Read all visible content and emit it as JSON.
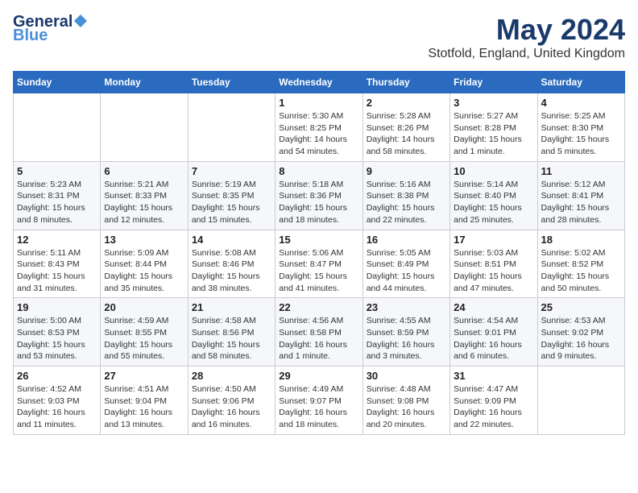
{
  "header": {
    "logo_general": "General",
    "logo_blue": "Blue",
    "title": "May 2024",
    "location": "Stotfold, England, United Kingdom"
  },
  "weekdays": [
    "Sunday",
    "Monday",
    "Tuesday",
    "Wednesday",
    "Thursday",
    "Friday",
    "Saturday"
  ],
  "weeks": [
    [
      {
        "day": "",
        "info": ""
      },
      {
        "day": "",
        "info": ""
      },
      {
        "day": "",
        "info": ""
      },
      {
        "day": "1",
        "info": "Sunrise: 5:30 AM\nSunset: 8:25 PM\nDaylight: 14 hours\nand 54 minutes."
      },
      {
        "day": "2",
        "info": "Sunrise: 5:28 AM\nSunset: 8:26 PM\nDaylight: 14 hours\nand 58 minutes."
      },
      {
        "day": "3",
        "info": "Sunrise: 5:27 AM\nSunset: 8:28 PM\nDaylight: 15 hours\nand 1 minute."
      },
      {
        "day": "4",
        "info": "Sunrise: 5:25 AM\nSunset: 8:30 PM\nDaylight: 15 hours\nand 5 minutes."
      }
    ],
    [
      {
        "day": "5",
        "info": "Sunrise: 5:23 AM\nSunset: 8:31 PM\nDaylight: 15 hours\nand 8 minutes."
      },
      {
        "day": "6",
        "info": "Sunrise: 5:21 AM\nSunset: 8:33 PM\nDaylight: 15 hours\nand 12 minutes."
      },
      {
        "day": "7",
        "info": "Sunrise: 5:19 AM\nSunset: 8:35 PM\nDaylight: 15 hours\nand 15 minutes."
      },
      {
        "day": "8",
        "info": "Sunrise: 5:18 AM\nSunset: 8:36 PM\nDaylight: 15 hours\nand 18 minutes."
      },
      {
        "day": "9",
        "info": "Sunrise: 5:16 AM\nSunset: 8:38 PM\nDaylight: 15 hours\nand 22 minutes."
      },
      {
        "day": "10",
        "info": "Sunrise: 5:14 AM\nSunset: 8:40 PM\nDaylight: 15 hours\nand 25 minutes."
      },
      {
        "day": "11",
        "info": "Sunrise: 5:12 AM\nSunset: 8:41 PM\nDaylight: 15 hours\nand 28 minutes."
      }
    ],
    [
      {
        "day": "12",
        "info": "Sunrise: 5:11 AM\nSunset: 8:43 PM\nDaylight: 15 hours\nand 31 minutes."
      },
      {
        "day": "13",
        "info": "Sunrise: 5:09 AM\nSunset: 8:44 PM\nDaylight: 15 hours\nand 35 minutes."
      },
      {
        "day": "14",
        "info": "Sunrise: 5:08 AM\nSunset: 8:46 PM\nDaylight: 15 hours\nand 38 minutes."
      },
      {
        "day": "15",
        "info": "Sunrise: 5:06 AM\nSunset: 8:47 PM\nDaylight: 15 hours\nand 41 minutes."
      },
      {
        "day": "16",
        "info": "Sunrise: 5:05 AM\nSunset: 8:49 PM\nDaylight: 15 hours\nand 44 minutes."
      },
      {
        "day": "17",
        "info": "Sunrise: 5:03 AM\nSunset: 8:51 PM\nDaylight: 15 hours\nand 47 minutes."
      },
      {
        "day": "18",
        "info": "Sunrise: 5:02 AM\nSunset: 8:52 PM\nDaylight: 15 hours\nand 50 minutes."
      }
    ],
    [
      {
        "day": "19",
        "info": "Sunrise: 5:00 AM\nSunset: 8:53 PM\nDaylight: 15 hours\nand 53 minutes."
      },
      {
        "day": "20",
        "info": "Sunrise: 4:59 AM\nSunset: 8:55 PM\nDaylight: 15 hours\nand 55 minutes."
      },
      {
        "day": "21",
        "info": "Sunrise: 4:58 AM\nSunset: 8:56 PM\nDaylight: 15 hours\nand 58 minutes."
      },
      {
        "day": "22",
        "info": "Sunrise: 4:56 AM\nSunset: 8:58 PM\nDaylight: 16 hours\nand 1 minute."
      },
      {
        "day": "23",
        "info": "Sunrise: 4:55 AM\nSunset: 8:59 PM\nDaylight: 16 hours\nand 3 minutes."
      },
      {
        "day": "24",
        "info": "Sunrise: 4:54 AM\nSunset: 9:01 PM\nDaylight: 16 hours\nand 6 minutes."
      },
      {
        "day": "25",
        "info": "Sunrise: 4:53 AM\nSunset: 9:02 PM\nDaylight: 16 hours\nand 9 minutes."
      }
    ],
    [
      {
        "day": "26",
        "info": "Sunrise: 4:52 AM\nSunset: 9:03 PM\nDaylight: 16 hours\nand 11 minutes."
      },
      {
        "day": "27",
        "info": "Sunrise: 4:51 AM\nSunset: 9:04 PM\nDaylight: 16 hours\nand 13 minutes."
      },
      {
        "day": "28",
        "info": "Sunrise: 4:50 AM\nSunset: 9:06 PM\nDaylight: 16 hours\nand 16 minutes."
      },
      {
        "day": "29",
        "info": "Sunrise: 4:49 AM\nSunset: 9:07 PM\nDaylight: 16 hours\nand 18 minutes."
      },
      {
        "day": "30",
        "info": "Sunrise: 4:48 AM\nSunset: 9:08 PM\nDaylight: 16 hours\nand 20 minutes."
      },
      {
        "day": "31",
        "info": "Sunrise: 4:47 AM\nSunset: 9:09 PM\nDaylight: 16 hours\nand 22 minutes."
      },
      {
        "day": "",
        "info": ""
      }
    ]
  ]
}
